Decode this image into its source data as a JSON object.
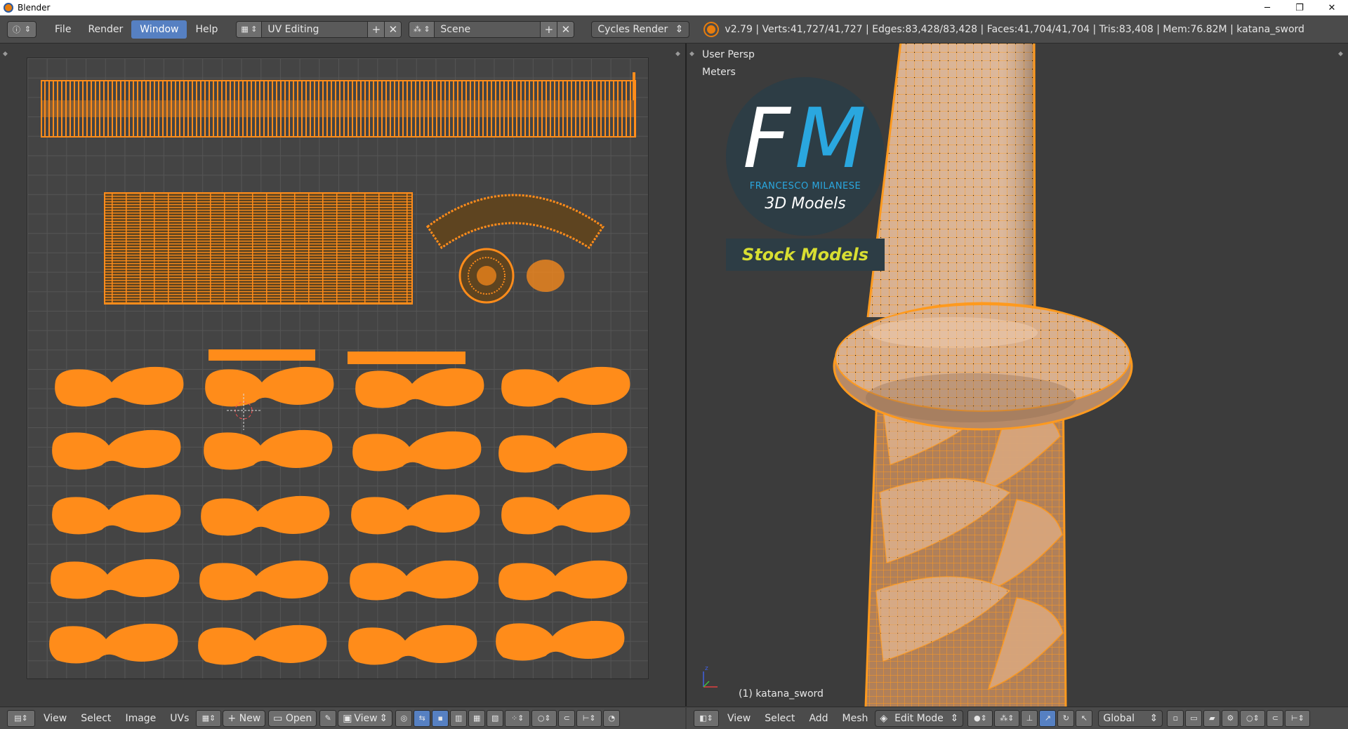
{
  "window": {
    "title": "Blender",
    "minimize_glyph": "─",
    "restore_glyph": "❐",
    "close_glyph": "✕"
  },
  "info_header": {
    "menus": [
      {
        "label": "File"
      },
      {
        "label": "Render"
      },
      {
        "label": "Window"
      },
      {
        "label": "Help"
      }
    ],
    "active_menu": "Window",
    "layout_name": "UV Editing",
    "scene_name": "Scene",
    "render_engine": "Cycles Render",
    "stats": "v2.79 | Verts:41,727/41,727 | Edges:83,428/83,428 | Faces:41,704/41,704 | Tris:83,408 | Mem:76.82M | katana_sword",
    "add_glyph": "+",
    "remove_glyph": "✕",
    "updown_glyph": "⇕"
  },
  "viewport": {
    "view_name": "User Persp",
    "units": "Meters",
    "object_label": "(1) katana_sword",
    "logo": {
      "letters_white": "F",
      "letters_blue": "M",
      "author": "FRANCESCO MILANESE",
      "tagline": "3D Models",
      "badge": "Stock Models"
    },
    "gizmo": {
      "x": "x",
      "y": "y",
      "z": "z"
    }
  },
  "uv_header": {
    "menus": [
      {
        "label": "View"
      },
      {
        "label": "Select"
      },
      {
        "label": "Image"
      },
      {
        "label": "UVs"
      }
    ],
    "new_label": "New",
    "open_label": "Open",
    "view_label": "View"
  },
  "vp_header": {
    "menus": [
      {
        "label": "View"
      },
      {
        "label": "Select"
      },
      {
        "label": "Add"
      },
      {
        "label": "Mesh"
      }
    ],
    "mode_label": "Edit Mode",
    "orientation_label": "Global"
  },
  "colors": {
    "uv_orange": "#ff8c1a",
    "mesh_wire": "#ff9a1e",
    "accent_blue": "#5680c2",
    "fm_blue": "#2aa7df",
    "stock_yellow": "#d8de32"
  }
}
